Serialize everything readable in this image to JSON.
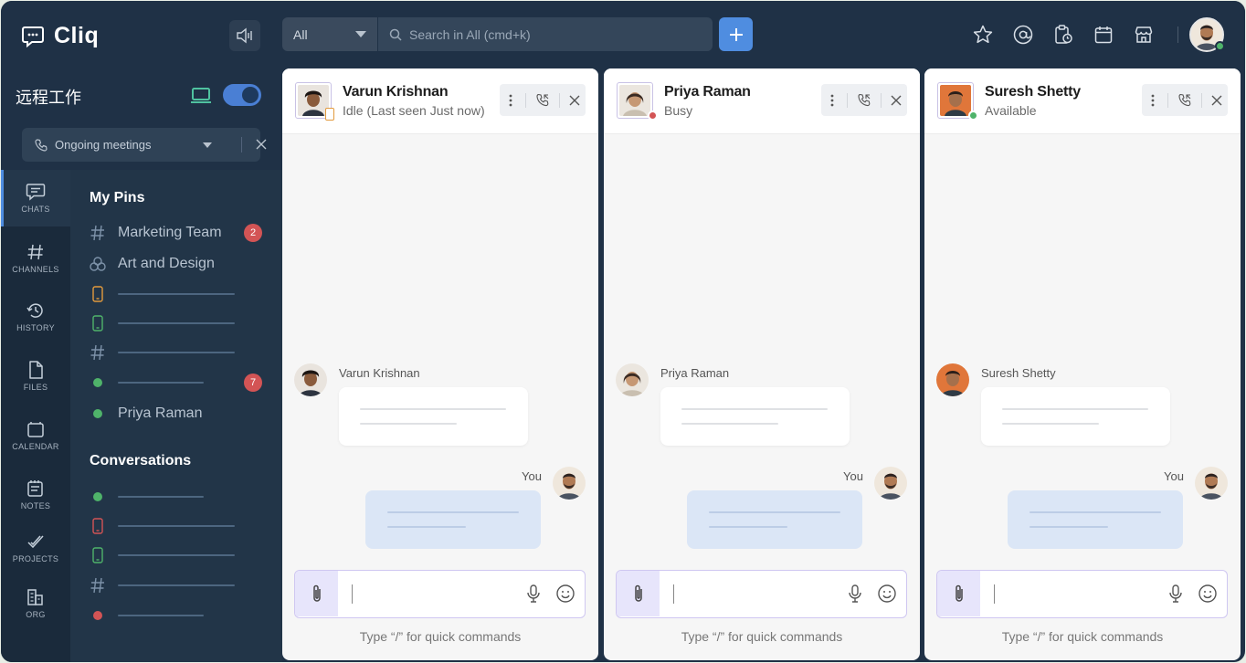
{
  "app": {
    "name": "Cliq"
  },
  "search": {
    "scope": "All",
    "placeholder": "Search in All (cmd+k)"
  },
  "top_icons": [
    "star-icon",
    "mention-icon",
    "reminder-icon",
    "calendar-icon",
    "store-icon"
  ],
  "workspace": {
    "name": "远程工作"
  },
  "meeting_bar": {
    "label": "Ongoing meetings"
  },
  "rail": [
    {
      "id": "chats",
      "label": "CHATS",
      "active": true
    },
    {
      "id": "channels",
      "label": "CHANNELS",
      "active": false
    },
    {
      "id": "history",
      "label": "HISTORY",
      "active": false
    },
    {
      "id": "files",
      "label": "FILES",
      "active": false
    },
    {
      "id": "calendar",
      "label": "CALENDAR",
      "active": false
    },
    {
      "id": "notes",
      "label": "NOTES",
      "active": false
    },
    {
      "id": "projects",
      "label": "PROJECTS",
      "active": false
    },
    {
      "id": "org",
      "label": "ORG",
      "active": false
    }
  ],
  "pins": {
    "title": "My Pins",
    "items": [
      {
        "label": "Marketing Team",
        "icon": "hash-icon",
        "badge": "2"
      },
      {
        "label": "Art and Design",
        "icon": "group-icon"
      },
      {
        "label": "Priya Raman",
        "icon": "online-dot"
      }
    ],
    "badge_second": "7"
  },
  "conversations": {
    "title": "Conversations"
  },
  "panes": [
    {
      "name": "Varun Krishnan",
      "status": "Idle (Last seen Just now)",
      "status_kind": "idle",
      "sender": "Varun Krishnan",
      "you": "You",
      "hint": "Type “/” for quick commands"
    },
    {
      "name": "Priya Raman",
      "status": "Busy",
      "status_kind": "busy",
      "sender": "Priya Raman",
      "you": "You",
      "hint": "Type “/” for quick commands"
    },
    {
      "name": "Suresh Shetty",
      "status": "Available",
      "status_kind": "available",
      "sender": "Suresh Shetty",
      "you": "You",
      "hint": "Type “/” for quick commands"
    }
  ],
  "colors": {
    "frame": "#1f3146",
    "accent": "#4f8de0",
    "busy": "#d35455",
    "available": "#4fb36a",
    "idle": "#e29a3d",
    "badge": "#d35455"
  }
}
